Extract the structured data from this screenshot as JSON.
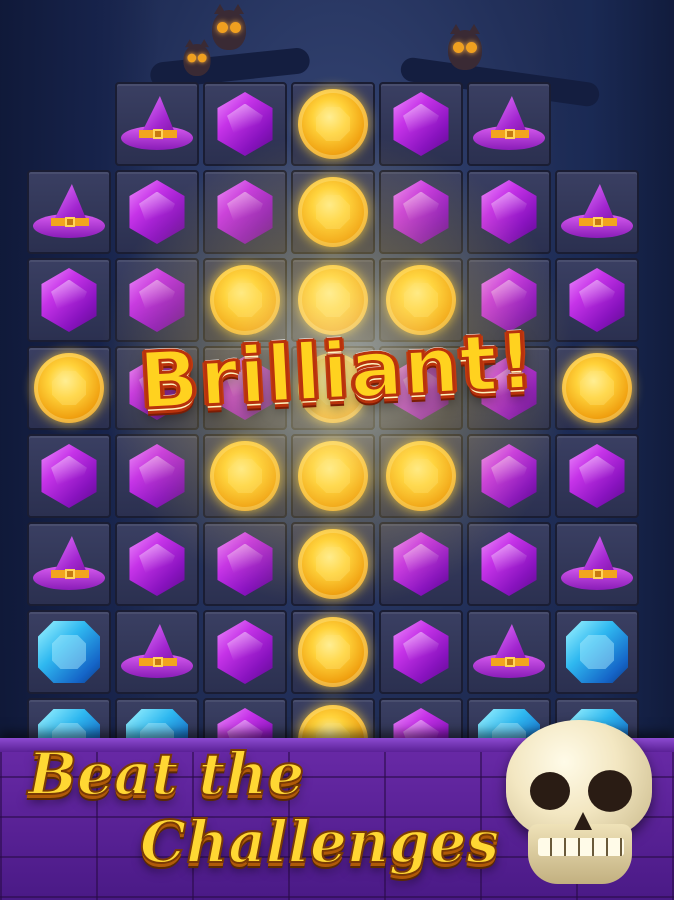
{
  "game": {
    "combo_text": "Brilliant!",
    "slogan_line1": "Beat the",
    "slogan_line2": "Challenges"
  },
  "board": {
    "rows": [
      [
        null,
        "hat",
        "purple",
        "gold",
        "purple",
        "hat",
        null
      ],
      [
        "hat",
        "purple",
        "purple",
        "gold",
        "purple",
        "purple",
        "hat"
      ],
      [
        "purple",
        "purple",
        "gold",
        "gold",
        "gold",
        "purple",
        "purple"
      ],
      [
        "gold",
        "purple",
        "purple",
        "gold",
        "purple",
        "purple",
        "gold"
      ],
      [
        "purple",
        "purple",
        "gold",
        "gold",
        "gold",
        "purple",
        "purple"
      ],
      [
        "hat",
        "purple",
        "purple",
        "gold",
        "purple",
        "purple",
        "hat"
      ],
      [
        "blue",
        "hat",
        "purple",
        "gold",
        "purple",
        "hat",
        "blue"
      ],
      [
        "blue",
        "blue",
        "purple",
        "gold",
        "purple",
        "blue",
        "blue"
      ]
    ]
  },
  "decor": {
    "owls": [
      "owl-icon",
      "owl-icon",
      "owl-icon"
    ],
    "skull": "skull-icon"
  },
  "colors": {
    "combo_fill": "#ffd21f",
    "combo_outline": "#b8320c",
    "footer_bg": "#5a2096",
    "slogan_fill": "#ffd733"
  }
}
